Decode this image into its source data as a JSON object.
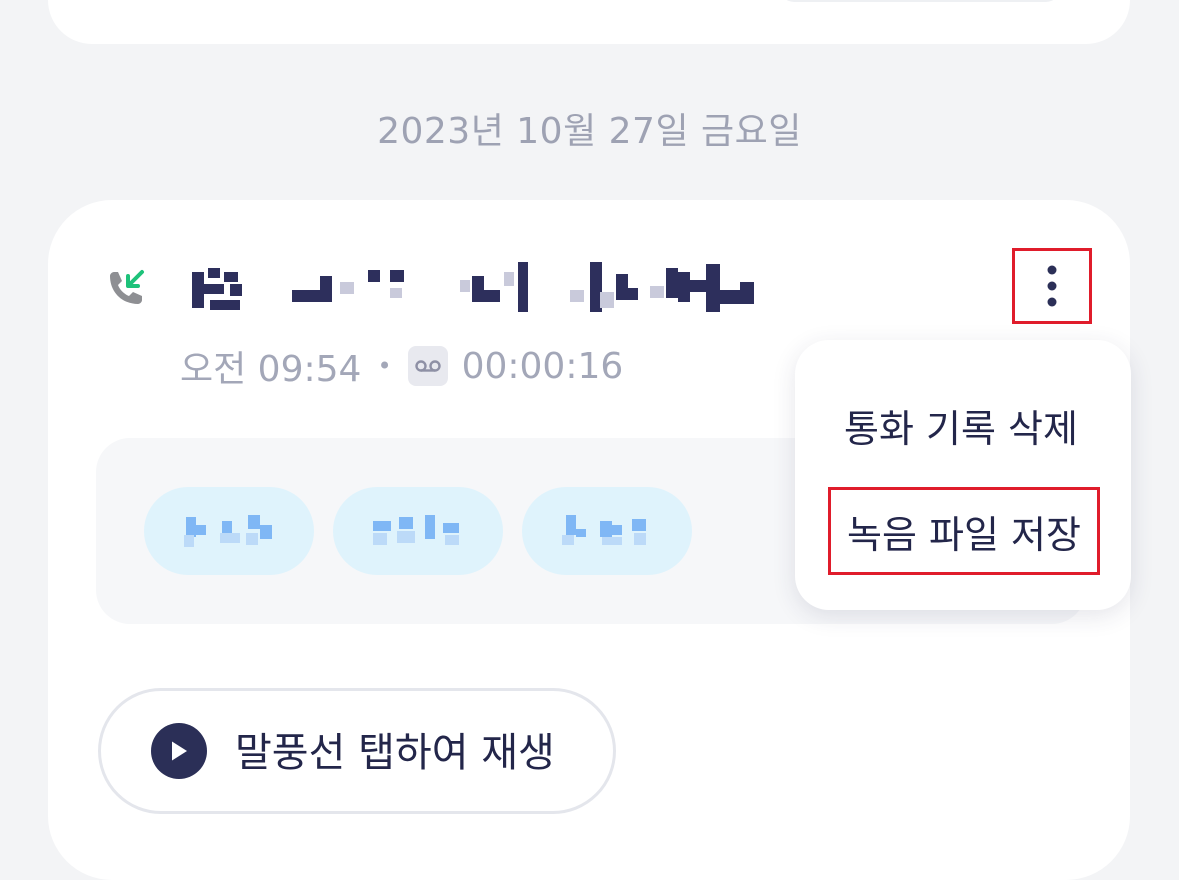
{
  "date_header": "2023년 10월 27일 금요일",
  "call": {
    "direction_icon": "incoming-call-icon",
    "time": "오전 09:54",
    "separator": "•",
    "duration_icon": "voicemail-icon",
    "duration": "00:00:16",
    "more_icon": "more-vertical-icon"
  },
  "menu": {
    "items": [
      {
        "label": "통화 기록 삭제"
      },
      {
        "label": "녹음 파일 저장"
      }
    ]
  },
  "play": {
    "icon": "play-icon",
    "label": "말풍선 탭하여 재생"
  },
  "colors": {
    "accent_dark": "#2b2f57",
    "incoming_green": "#1ec27a",
    "chip_bg": "#dff3fc",
    "highlight_red": "#e01c2b"
  }
}
